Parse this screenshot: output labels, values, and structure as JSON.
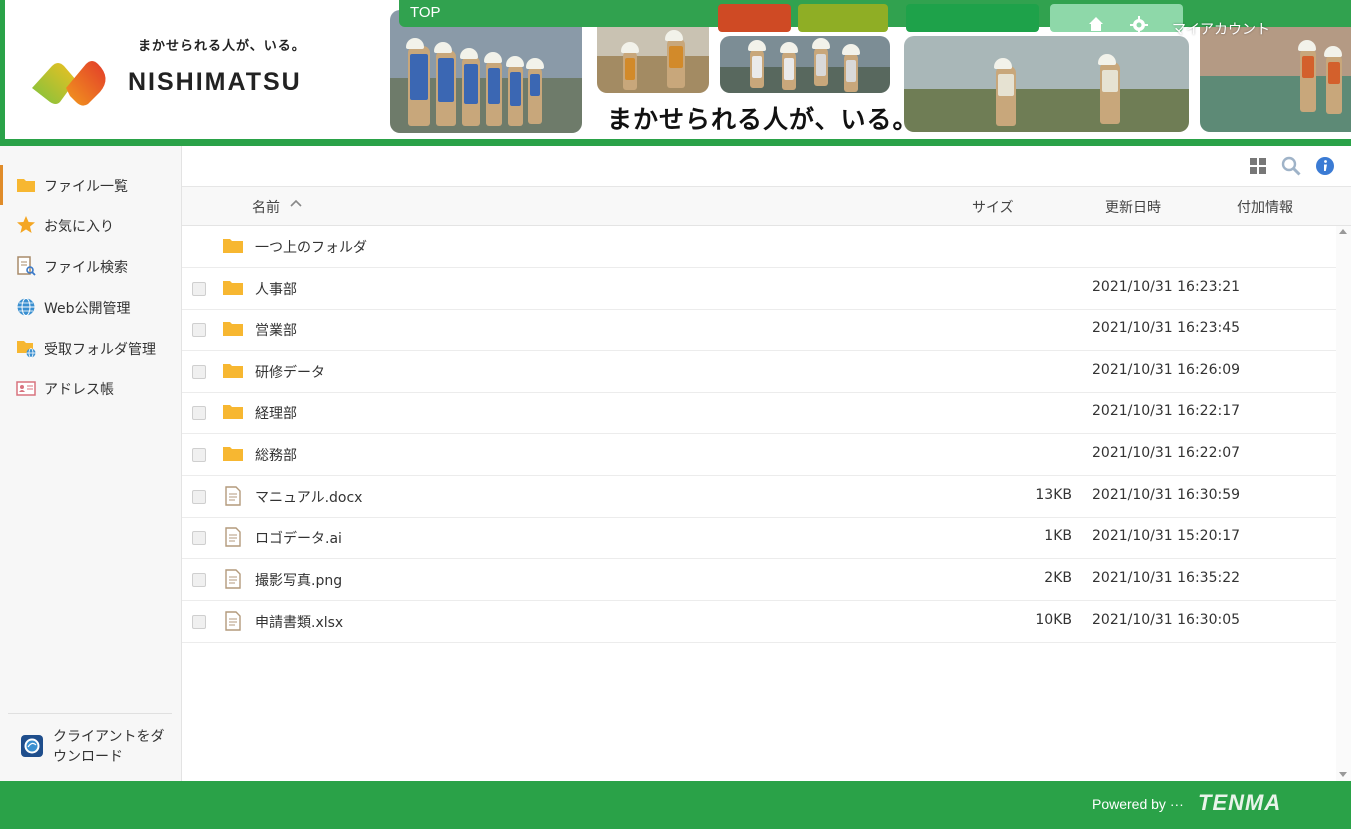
{
  "header": {
    "logo_tagline": "まかせられる人が、いる。",
    "logo_name": "NISHIMATSU",
    "slogan": "まかせられる人が、いる。",
    "nav_top": "TOP",
    "account": "マイアカウント",
    "brand_green": "#2aa248"
  },
  "sidebar": {
    "items": [
      {
        "label": "ファイル一覧",
        "icon": "folder-icon",
        "active": true
      },
      {
        "label": "お気に入り",
        "icon": "star-icon"
      },
      {
        "label": "ファイル検索",
        "icon": "file-search-icon"
      },
      {
        "label": "Web公開管理",
        "icon": "globe-icon"
      },
      {
        "label": "受取フォルダ管理",
        "icon": "receive-folder-icon"
      },
      {
        "label": "アドレス帳",
        "icon": "address-book-icon"
      }
    ],
    "client_download": "クライアントをダウンロード",
    "active_color": "#e08c2a"
  },
  "table": {
    "headers": {
      "name": "名前",
      "size": "サイズ",
      "modified": "更新日時",
      "extra": "付加情報"
    },
    "parent_folder": "一つ上のフォルダ",
    "rows": [
      {
        "type": "folder",
        "name": "人事部",
        "size": "",
        "modified": "2021/10/31 16:23:21"
      },
      {
        "type": "folder",
        "name": "営業部",
        "size": "",
        "modified": "2021/10/31 16:23:45"
      },
      {
        "type": "folder",
        "name": "研修データ",
        "size": "",
        "modified": "2021/10/31 16:26:09"
      },
      {
        "type": "folder",
        "name": "経理部",
        "size": "",
        "modified": "2021/10/31 16:22:17"
      },
      {
        "type": "folder",
        "name": "総務部",
        "size": "",
        "modified": "2021/10/31 16:22:07"
      },
      {
        "type": "file",
        "name": "マニュアル.docx",
        "size": "13KB",
        "modified": "2021/10/31 16:30:59"
      },
      {
        "type": "file",
        "name": "ロゴデータ.ai",
        "size": "1KB",
        "modified": "2021/10/31 15:20:17"
      },
      {
        "type": "file",
        "name": "撮影写真.png",
        "size": "2KB",
        "modified": "2021/10/31 16:35:22"
      },
      {
        "type": "file",
        "name": "申請書類.xlsx",
        "size": "10KB",
        "modified": "2021/10/31 16:30:05"
      }
    ],
    "folder_color": "#f7b731"
  },
  "footer": {
    "powered": "Powered by ···",
    "brand": "TENMA"
  }
}
